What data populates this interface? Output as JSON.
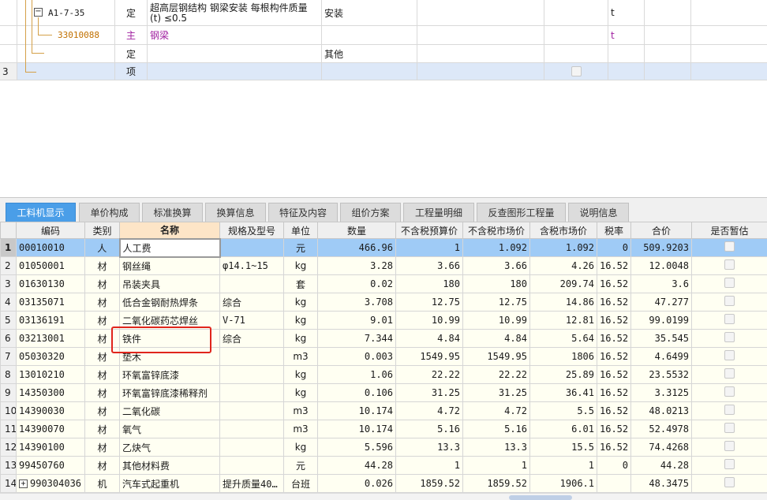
{
  "top_rows": [
    {
      "row_no": "",
      "code": "A1-7-35",
      "type": "定",
      "name_line1": "超高层钢结构 钢梁安装 每根构件质量",
      "name_line2": "(t) ≤0.5",
      "spec": "安装",
      "unit": "t"
    },
    {
      "row_no": "",
      "code": "33010088",
      "type": "主",
      "name": "钢梁",
      "spec": "",
      "unit": "t"
    },
    {
      "row_no": "",
      "code": "",
      "type": "定",
      "name": "",
      "spec": "其他",
      "unit": ""
    },
    {
      "row_no": "3",
      "code": "",
      "type": "项",
      "name": "",
      "spec": "",
      "unit": ""
    }
  ],
  "tabs": [
    {
      "label": "工料机显示",
      "active": true
    },
    {
      "label": "单价构成",
      "active": false
    },
    {
      "label": "标准换算",
      "active": false
    },
    {
      "label": "换算信息",
      "active": false
    },
    {
      "label": "特征及内容",
      "active": false
    },
    {
      "label": "组价方案",
      "active": false
    },
    {
      "label": "工程量明细",
      "active": false
    },
    {
      "label": "反查图形工程量",
      "active": false
    },
    {
      "label": "说明信息",
      "active": false
    }
  ],
  "table": {
    "headers": [
      "",
      "编码",
      "类别",
      "名称",
      "规格及型号",
      "单位",
      "数量",
      "不含税预算价",
      "不含税市场价",
      "含税市场价",
      "税率",
      "合价",
      "是否暂估"
    ],
    "rows": [
      [
        "1",
        "00010010",
        "人",
        "人工费",
        "",
        "元",
        "466.96",
        "1",
        "1.092",
        "1.092",
        "0",
        "509.9203"
      ],
      [
        "2",
        "01050001",
        "材",
        "钢丝绳",
        "φ14.1~15",
        "kg",
        "3.28",
        "3.66",
        "3.66",
        "4.26",
        "16.52",
        "12.0048"
      ],
      [
        "3",
        "01630130",
        "材",
        "吊装夹具",
        "",
        "套",
        "0.02",
        "180",
        "180",
        "209.74",
        "16.52",
        "3.6"
      ],
      [
        "4",
        "03135071",
        "材",
        "低合金钢耐热焊条",
        "综合",
        "kg",
        "3.708",
        "12.75",
        "12.75",
        "14.86",
        "16.52",
        "47.277"
      ],
      [
        "5",
        "03136191",
        "材",
        "二氧化碳药芯焊丝",
        "V-71",
        "kg",
        "9.01",
        "10.99",
        "10.99",
        "12.81",
        "16.52",
        "99.0199"
      ],
      [
        "6",
        "03213001",
        "材",
        "铁件",
        "综合",
        "kg",
        "7.344",
        "4.84",
        "4.84",
        "5.64",
        "16.52",
        "35.545"
      ],
      [
        "7",
        "05030320",
        "材",
        "垫木",
        "",
        "m3",
        "0.003",
        "1549.95",
        "1549.95",
        "1806",
        "16.52",
        "4.6499"
      ],
      [
        "8",
        "13010210",
        "材",
        "环氧富锌底漆",
        "",
        "kg",
        "1.06",
        "22.22",
        "22.22",
        "25.89",
        "16.52",
        "23.5532"
      ],
      [
        "9",
        "14350300",
        "材",
        "环氧富锌底漆稀释剂",
        "",
        "kg",
        "0.106",
        "31.25",
        "31.25",
        "36.41",
        "16.52",
        "3.3125"
      ],
      [
        "10",
        "14390030",
        "材",
        "二氧化碳",
        "",
        "m3",
        "10.174",
        "4.72",
        "4.72",
        "5.5",
        "16.52",
        "48.0213"
      ],
      [
        "11",
        "14390070",
        "材",
        "氧气",
        "",
        "m3",
        "10.174",
        "5.16",
        "5.16",
        "6.01",
        "16.52",
        "52.4978"
      ],
      [
        "12",
        "14390100",
        "材",
        "乙炔气",
        "",
        "kg",
        "5.596",
        "13.3",
        "13.3",
        "15.5",
        "16.52",
        "74.4268"
      ],
      [
        "13",
        "99450760",
        "材",
        "其他材料费",
        "",
        "元",
        "44.28",
        "1",
        "1",
        "1",
        "0",
        "44.28"
      ],
      [
        "14",
        "990304036",
        "机",
        "汽车式起重机",
        "提升质量40…",
        "台班",
        "0.026",
        "1859.52",
        "1859.52",
        "1906.1",
        "",
        "48.3475"
      ]
    ]
  },
  "colors": {
    "active_tab": "#4a9ee8",
    "selected_row": "#9fcbf6",
    "highlight": "#e0251d",
    "main_material": "#a020a0"
  }
}
